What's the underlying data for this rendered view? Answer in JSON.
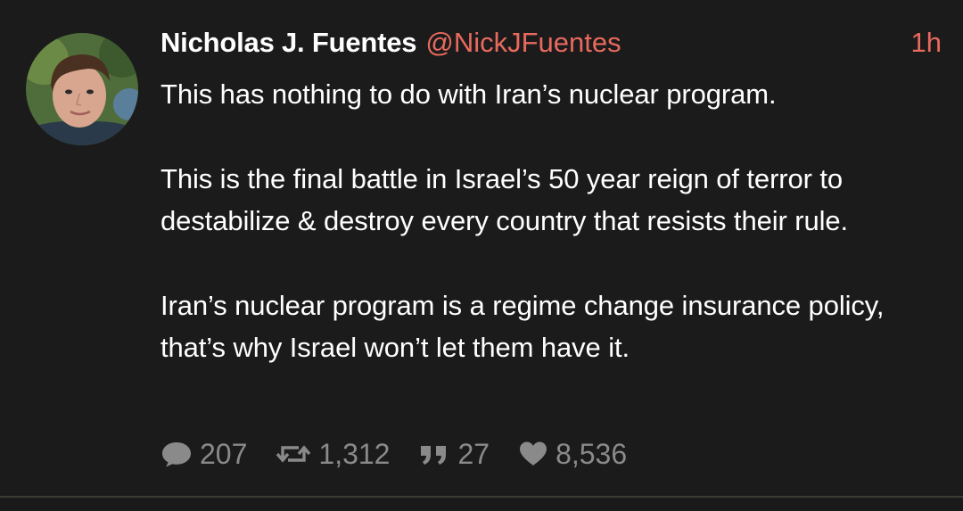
{
  "author": {
    "name": "Nicholas J. Fuentes",
    "handle": "@NickJFuentes",
    "timestamp": "1h"
  },
  "post": {
    "paragraphs": [
      "This has nothing to do with Iran’s nuclear program.",
      "This is the final battle in Israel’s 50 year reign of terror to destabilize & destroy every country that resists their rule.",
      "Iran’s nuclear program is a regime change insurance policy, that’s why Israel won’t let them have it."
    ]
  },
  "stats": {
    "replies": "207",
    "reposts": "1,312",
    "quotes": "27",
    "likes": "8,536"
  },
  "icons": {
    "replies": "speech-bubble-icon",
    "reposts": "repost-icon",
    "quotes": "quote-icon",
    "likes": "heart-icon"
  },
  "colors": {
    "background": "#1b1b1b",
    "accent": "#e8695e",
    "muted": "#8a8a8a",
    "text": "#ffffff"
  }
}
